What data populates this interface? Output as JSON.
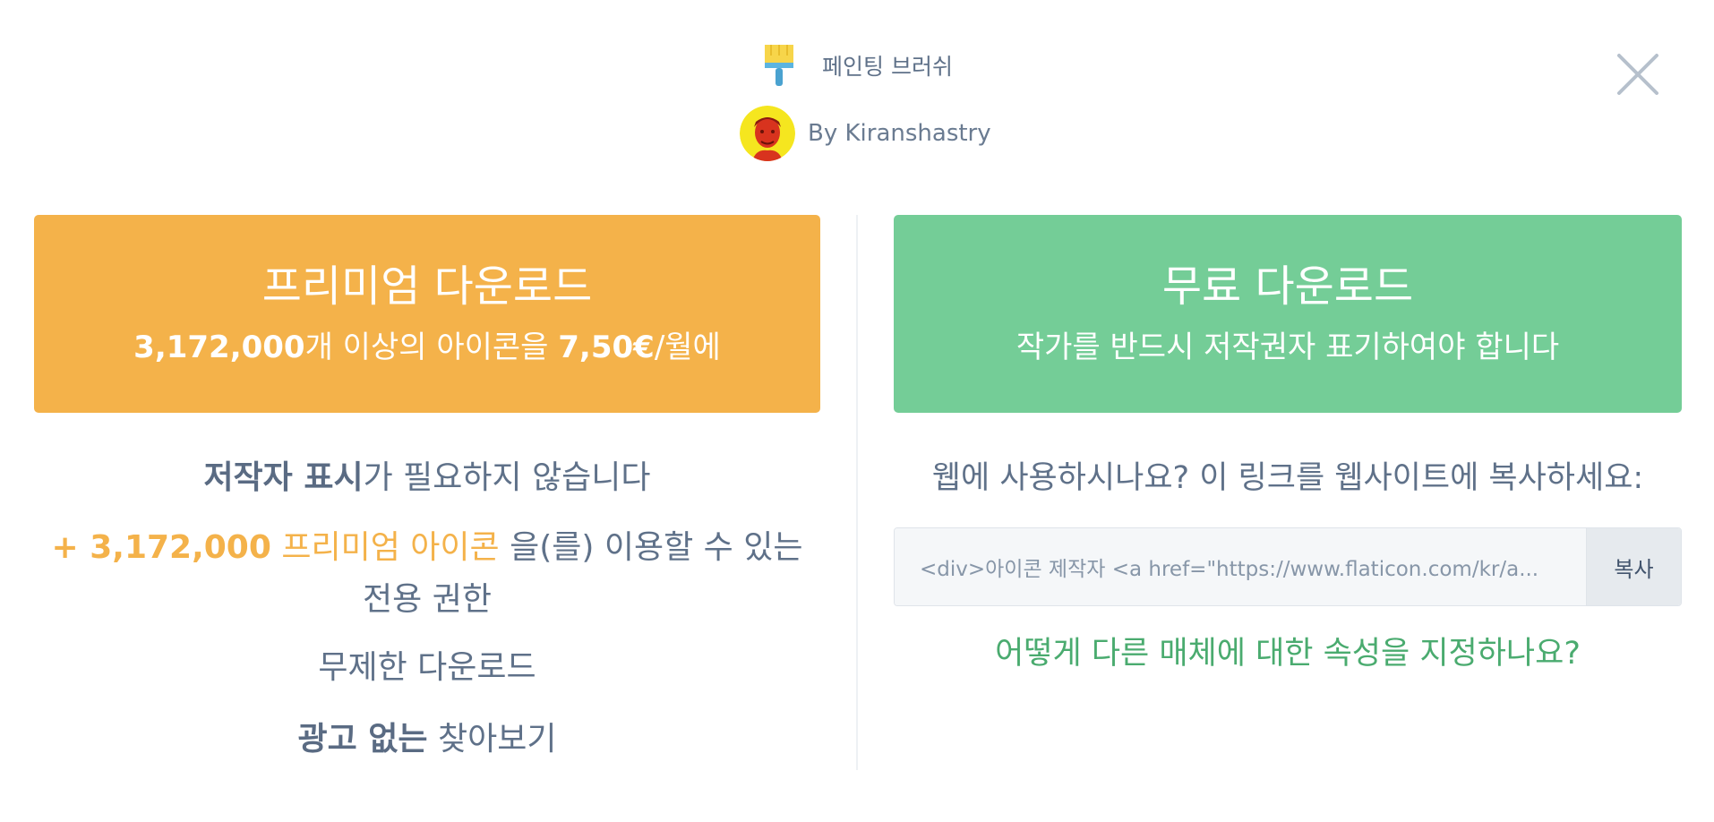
{
  "header": {
    "icon_name": "paint-brush-icon",
    "icon_title": "페인팅 브러쉬",
    "author": "By Kiranshastry",
    "close_icon": "close-icon"
  },
  "premium": {
    "title": "프리미엄 다운로드",
    "sub_count": "3,172,000",
    "sub_mid": "개 이상의 아이콘을 ",
    "sub_price": "7,50€",
    "sub_end": "/월에",
    "color": "#f4b24a"
  },
  "features": {
    "f1_bold": "저작자 표시",
    "f1_rest": "가 필요하지 않습니다",
    "f2_count": "+ 3,172,000",
    "f2_highlight": " 프리미엄 아이콘",
    "f2_rest": " 을(를) 이용할 수 있는 전용 권한",
    "f3": "무제한 다운로드",
    "f4_bold": "광고 없는",
    "f4_rest": " 찾아보기"
  },
  "free": {
    "title": "무료 다운로드",
    "subtitle": "작가를 반드시 저작권자 표기하여야 합니다",
    "color": "#74cd97",
    "web_note": "웹에 사용하시나요? 이 링크를 웹사이트에 복사하세요:",
    "code_value": "<div>아이콘 제작자 <a href=\"https://www.flaticon.com/kr/a...",
    "copy_label": "복사",
    "attr_link": "어떻게 다른 매체에 대한 속성을 지정하나요?"
  }
}
